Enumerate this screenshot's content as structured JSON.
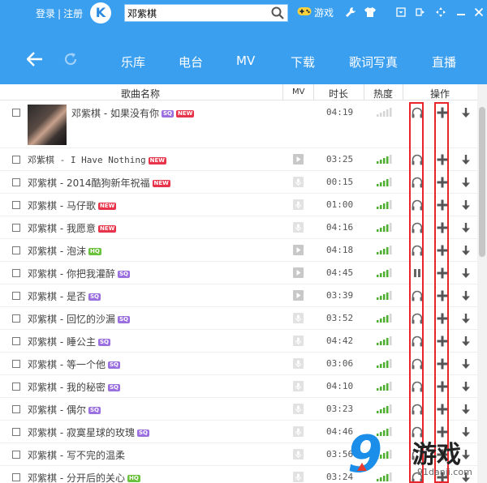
{
  "topbar": {
    "login": "登录",
    "sep": "|",
    "register": "注册",
    "logo_letter": "K",
    "search_value": "邓紫棋",
    "game_label": "游戏"
  },
  "nav": {
    "items": [
      "乐库",
      "电台",
      "MV",
      "下载",
      "歌词写真",
      "直播"
    ]
  },
  "table": {
    "headers": {
      "name": "歌曲名称",
      "mv": "MV",
      "duration": "时长",
      "heat": "热度",
      "ops": "操作"
    },
    "rows": [
      {
        "title": "邓紫棋 - 如果没有你",
        "badges": [
          "SQ",
          "NEW"
        ],
        "mv": false,
        "duration": "04:19",
        "heat": 0,
        "state": "play"
      },
      {
        "title": "邓紫棋 - I Have Nothing",
        "badges": [
          "NEW"
        ],
        "mv": true,
        "duration": "03:25",
        "heat": 4,
        "state": "play"
      },
      {
        "title": "邓紫棋 - 2014酷狗新年祝福",
        "badges": [
          "NEW"
        ],
        "mv": false,
        "duration": "00:15",
        "heat": 4,
        "state": "play"
      },
      {
        "title": "邓紫棋 - 马仔歌",
        "badges": [
          "NEW"
        ],
        "mv": false,
        "duration": "01:00",
        "heat": 4,
        "state": "play"
      },
      {
        "title": "邓紫棋 - 我愿意",
        "badges": [
          "NEW"
        ],
        "mv": false,
        "duration": "04:16",
        "heat": 4,
        "state": "play"
      },
      {
        "title": "邓紫棋 - 泡沫",
        "badges": [
          "HQ"
        ],
        "mv": true,
        "duration": "04:18",
        "heat": 4,
        "state": "play"
      },
      {
        "title": "邓紫棋 - 你把我灌醉",
        "badges": [
          "SQ"
        ],
        "mv": true,
        "duration": "04:45",
        "heat": 4,
        "state": "pause"
      },
      {
        "title": "邓紫棋 - 是否",
        "badges": [
          "SQ"
        ],
        "mv": true,
        "duration": "03:39",
        "heat": 4,
        "state": "play"
      },
      {
        "title": "邓紫棋 - 回忆的沙漏",
        "badges": [
          "SQ"
        ],
        "mv": false,
        "duration": "03:52",
        "heat": 4,
        "state": "play"
      },
      {
        "title": "邓紫棋 - 睡公主",
        "badges": [
          "SQ"
        ],
        "mv": false,
        "duration": "04:42",
        "heat": 4,
        "state": "play"
      },
      {
        "title": "邓紫棋 - 等一个他",
        "badges": [
          "SQ"
        ],
        "mv": false,
        "duration": "03:06",
        "heat": 4,
        "state": "play"
      },
      {
        "title": "邓紫棋 - 我的秘密",
        "badges": [
          "SQ"
        ],
        "mv": false,
        "duration": "04:10",
        "heat": 4,
        "state": "play"
      },
      {
        "title": "邓紫棋 - 偶尔",
        "badges": [
          "SQ"
        ],
        "mv": false,
        "duration": "03:23",
        "heat": 4,
        "state": "play"
      },
      {
        "title": "邓紫棋 - 寂寞星球的玫瑰",
        "badges": [
          "SQ"
        ],
        "mv": false,
        "duration": "04:46",
        "heat": 4,
        "state": "play"
      },
      {
        "title": "邓紫棋 - 写不完的温柔",
        "badges": [],
        "mv": false,
        "duration": "03:56",
        "heat": 4,
        "state": "play"
      },
      {
        "title": "邓紫棋 - 分开后的关心",
        "badges": [
          "HQ"
        ],
        "mv": false,
        "duration": "03:24",
        "heat": 4,
        "state": "play"
      }
    ]
  },
  "watermark": {
    "mark": "9",
    "name": "游戏",
    "url": "91danji.com"
  },
  "colors": {
    "accent": "#3b9ff0",
    "highlight": "#e8252a",
    "heat": "#4caf2e",
    "sq": "#9b6fe0",
    "new": "#e8344a",
    "hq": "#6ac23c"
  }
}
